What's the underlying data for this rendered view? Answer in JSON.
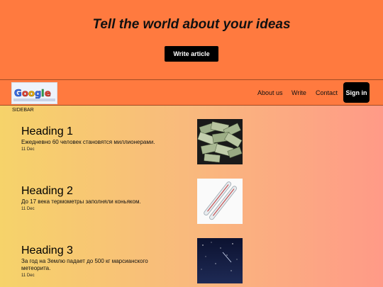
{
  "hero": {
    "title": "Tell the world about your ideas",
    "write_button": "Write article"
  },
  "nav": {
    "logo_alt": "Google",
    "links": [
      "About us",
      "Write",
      "Contact"
    ],
    "signin": "Sign in"
  },
  "sidebar": {
    "label": "SIDEBAR"
  },
  "articles": [
    {
      "heading": "Heading 1",
      "text": "Ежедневно 60 человек становятся миллионерами.",
      "date": "11 Dec",
      "image": "money-pile-image"
    },
    {
      "heading": "Heading 2",
      "text": "До 17 века термометры заполняли коньяком.",
      "date": "11 Dec",
      "image": "thermometers-image"
    },
    {
      "heading": "Heading 3",
      "text": "За год на Землю падает до 500 кг марсианского метеорита.",
      "date": "11 Dec",
      "image": "night-sky-image"
    }
  ],
  "colors": {
    "accent": "#ff7a3f",
    "button": "#000000"
  }
}
